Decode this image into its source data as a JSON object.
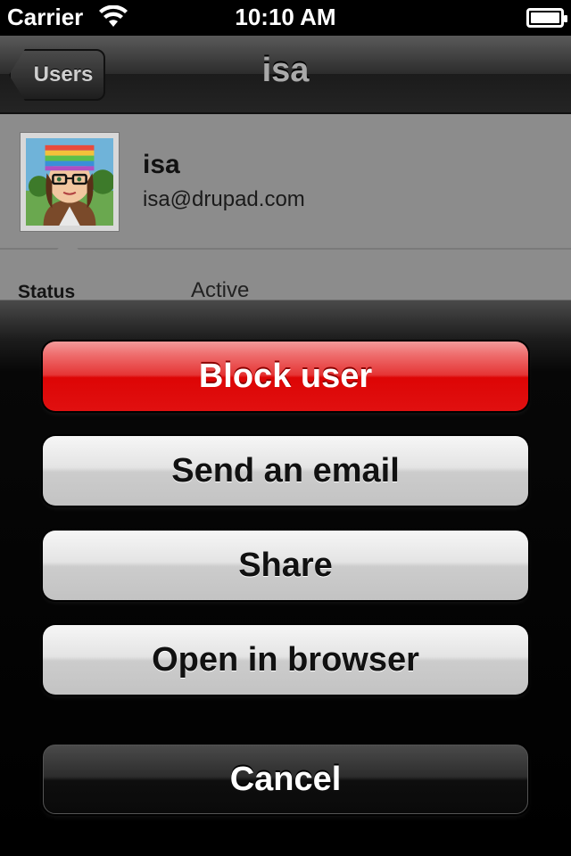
{
  "status_bar": {
    "carrier": "Carrier",
    "time": "10:10 AM",
    "wifi_icon": "wifi-icon",
    "battery_icon": "battery-icon"
  },
  "nav": {
    "back_label": "Users",
    "title": "isa"
  },
  "profile": {
    "name": "isa",
    "email": "isa@drupad.com",
    "avatar_icon": "avatar-image"
  },
  "details": {
    "status_label": "Status",
    "status_value": "Active"
  },
  "action_sheet": {
    "block_label": "Block user",
    "email_label": "Send an email",
    "share_label": "Share",
    "browser_label": "Open in browser",
    "cancel_label": "Cancel"
  },
  "colors": {
    "destructive": "#dd0505",
    "sheet_background": "#000000"
  }
}
